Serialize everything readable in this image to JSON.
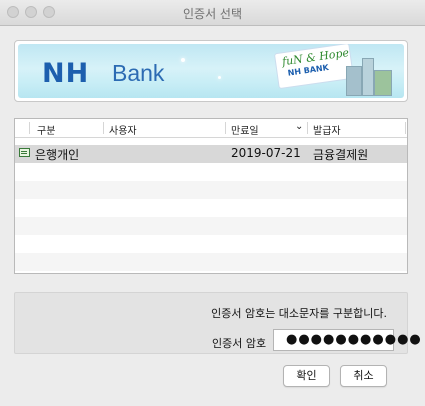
{
  "window": {
    "title": "인증서 선택"
  },
  "banner": {
    "brand": "NH",
    "bank_text": "Bank",
    "slogan": "fuN & Hope",
    "slogan_brand": "NH BANK"
  },
  "table": {
    "columns": [
      "구분",
      "사용자",
      "만료일",
      "발급자"
    ],
    "sorted_column_indicator": "chevron-down-icon",
    "rows": [
      {
        "type": "은행개인",
        "user": "",
        "expiry": "2019-07-21",
        "issuer": "금융결제원",
        "selected": true
      }
    ]
  },
  "password": {
    "notice": "인증서 암호는 대소문자를 구분합니다.",
    "label": "인증서 암호",
    "value": "●●●●●●●●●●●"
  },
  "buttons": {
    "ok": "확인",
    "cancel": "취소"
  }
}
